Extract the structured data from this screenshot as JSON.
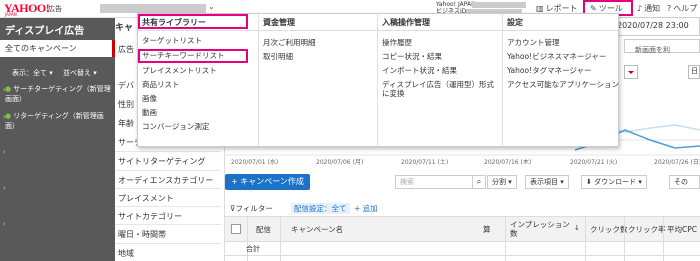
{
  "header": {
    "logo": "YAHOO!",
    "logo_sub": "JAPAN",
    "product": "広告",
    "business_line1": "Yahoo! JAPAN",
    "business_line2": "ビジネスID",
    "nav": [
      {
        "label": "レポート",
        "icon": "chart-icon"
      },
      {
        "label": "ツール",
        "icon": "wrench-icon"
      },
      {
        "label": "通知",
        "icon": "bell-icon"
      },
      {
        "label": "ヘルプ",
        "icon": "help-icon"
      }
    ],
    "highlight_color": "#e4007f"
  },
  "sidebar": {
    "title": "ディスプレイ広告",
    "all_campaigns": "全てのキャンペーン",
    "display_filter": "表示：全て",
    "sort": "並べ替え",
    "items": [
      "サーチターゲティング（新管理画面）",
      "リターゲティング（新管理画面）"
    ]
  },
  "main": {
    "left_menu": {
      "top_chip": "キャ",
      "items": [
        "広告",
        "デバ",
        "性別",
        "年齢",
        "サーチキーワード",
        "サイトリターゲティング",
        "オーディエンスカテゴリー",
        "プレイスメント",
        "サイトカテゴリー",
        "曜日・時間帯",
        "地域"
      ]
    },
    "date": "2020/07/28 23:00",
    "new_screen_text": "新画面を利",
    "chart_x_ticks": [
      "2020/07/01 (水)",
      "2020/07/06 (月)",
      "2020/07/11 (土)",
      "2020/07/16 (木)",
      "2020/07/21 (火)",
      "2020/07/26 (日)"
    ],
    "toolbar": {
      "create": "+ キャンペーン作成",
      "search_placeholder": "検索",
      "segment": "分割",
      "columns": "表示項目",
      "download": "ダウンロード",
      "more": "その"
    },
    "filter": {
      "label": "フィルター",
      "setting": "配信設定：全て",
      "add": "+ 追加"
    },
    "table": {
      "headers": [
        "配信",
        "キャンペーン名",
        "算",
        "インプレッション数",
        "クリック数",
        "クリック率",
        "平均CPC"
      ],
      "total_label": "合計"
    }
  },
  "mega_menu": {
    "columns": [
      {
        "title": "共有ライブラリー",
        "items": [
          "ターゲットリスト",
          "サーチキーワードリスト",
          "プレイスメントリスト",
          "商品リスト",
          "画像",
          "動画",
          "コンバージョン測定"
        ]
      },
      {
        "title": "資金管理",
        "items": [
          "月次ご利用明細",
          "取引明細"
        ]
      },
      {
        "title": "入稿操作管理",
        "items": [
          "操作履歴",
          "コピー状況・結果",
          "インポート状況・結果",
          "ディスプレイ広告（運用型）形式に変換"
        ]
      },
      {
        "title": "設定",
        "items": [
          "アカウント管理",
          "Yahoo!ビジネスマネージャー",
          "Yahoo!タグマネージャー",
          "アクセス可能なアプリケーション"
        ]
      }
    ]
  }
}
